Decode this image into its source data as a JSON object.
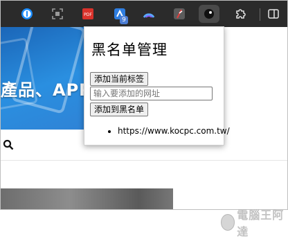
{
  "toolbar": {
    "extensions": [
      {
        "icon": "onepassword-icon"
      },
      {
        "icon": "screenshot-icon"
      },
      {
        "icon": "pdf-icon"
      },
      {
        "icon": "shortcut-extension-icon",
        "badge": "9"
      },
      {
        "icon": "arc-extension-icon"
      },
      {
        "icon": "feather-extension-icon"
      },
      {
        "icon": "blacklist-extension-icon"
      }
    ],
    "accent": "#4d7fd6"
  },
  "page": {
    "hero_text": "產品、APP"
  },
  "popup": {
    "title": "黑名单管理",
    "add_current_button": "添加当前标签",
    "url_placeholder": "输入要添加的网址",
    "add_to_blacklist_button": "添加到黑名单",
    "blacklist": [
      "https://www.kocpc.com.tw/"
    ]
  },
  "watermark": {
    "text": "電腦王阿達"
  }
}
